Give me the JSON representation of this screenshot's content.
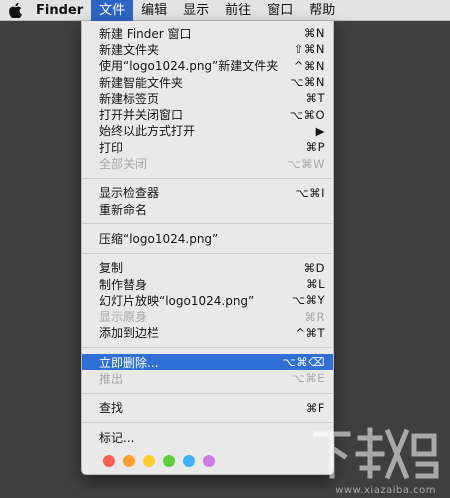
{
  "menubar": {
    "app_name": "Finder",
    "items": [
      {
        "label": "文件",
        "active": true
      },
      {
        "label": "编辑"
      },
      {
        "label": "显示"
      },
      {
        "label": "前往"
      },
      {
        "label": "窗口"
      },
      {
        "label": "帮助"
      }
    ]
  },
  "menu": {
    "items": [
      {
        "label": "新建 Finder 窗口",
        "shortcut": "⌘N"
      },
      {
        "label": "新建文件夹",
        "shortcut": "⇧⌘N"
      },
      {
        "label": "使用“logo1024.png”新建文件夹",
        "shortcut": "^⌘N"
      },
      {
        "label": "新建智能文件夹",
        "shortcut": "⌥⌘N"
      },
      {
        "label": "新建标签页",
        "shortcut": "⌘T"
      },
      {
        "label": "打开并关闭窗口",
        "shortcut": "⌥⌘O"
      },
      {
        "label": "始终以此方式打开",
        "shortcut": "▶"
      },
      {
        "label": "打印",
        "shortcut": "⌘P"
      },
      {
        "label": "全部关闭",
        "shortcut": "⌥⌘W",
        "disabled": true
      },
      {
        "separator": true
      },
      {
        "label": "显示检查器",
        "shortcut": "⌥⌘I"
      },
      {
        "label": "重新命名",
        "shortcut": ""
      },
      {
        "separator": true
      },
      {
        "label": "压缩“logo1024.png”",
        "shortcut": ""
      },
      {
        "separator": true
      },
      {
        "label": "复制",
        "shortcut": "⌘D"
      },
      {
        "label": "制作替身",
        "shortcut": "⌘L"
      },
      {
        "label": "幻灯片放映“logo1024.png”",
        "shortcut": "⌥⌘Y"
      },
      {
        "label": "显示原身",
        "shortcut": "⌘R",
        "disabled": true
      },
      {
        "label": "添加到边栏",
        "shortcut": "^⌘T"
      },
      {
        "separator": true
      },
      {
        "label": "立即删除...",
        "shortcut": "⌥⌘⌫",
        "highlight": true
      },
      {
        "label": "推出",
        "shortcut": "⌥⌘E",
        "disabled": true
      },
      {
        "separator": true
      },
      {
        "label": "查找",
        "shortcut": "⌘F"
      },
      {
        "separator": true
      },
      {
        "label": "标记...",
        "shortcut": ""
      }
    ],
    "tag_colors": [
      "#fc5f57",
      "#fd9e2f",
      "#fece2f",
      "#5ecd3f",
      "#40b0f8",
      "#cd7ce1"
    ],
    "tag_color_names": [
      "red-tag",
      "orange-tag",
      "yellow-tag",
      "green-tag",
      "blue-tag",
      "purple-tag"
    ]
  },
  "watermark": {
    "text": "下载吧",
    "site": "www.xiazaiba.com"
  }
}
